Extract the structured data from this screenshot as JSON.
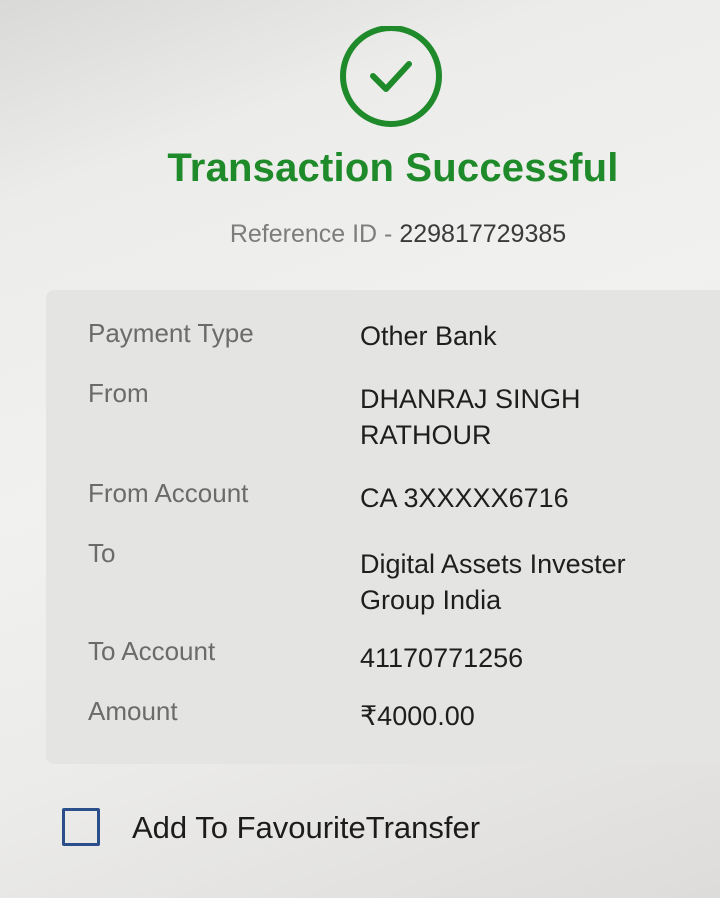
{
  "status": {
    "title": "Transaction Successful",
    "icon": "checkmark-circle-icon",
    "color": "#1f8a2a"
  },
  "reference": {
    "label": "Reference ID - ",
    "value": "229817729385"
  },
  "details": {
    "payment_type": {
      "label": "Payment Type",
      "value": "Other Bank"
    },
    "from": {
      "label": "From",
      "value": "DHANRAJ SINGH RATHOUR"
    },
    "from_account": {
      "label": "From Account",
      "value": "CA 3XXXXX6716"
    },
    "to": {
      "label": "To",
      "value": "Digital Assets Invester Group India"
    },
    "to_account": {
      "label": "To Account",
      "value": "41170771256"
    },
    "amount": {
      "label": "Amount",
      "value": "₹4000.00"
    }
  },
  "favourite": {
    "label": "Add To FavouriteTransfer",
    "checked": false
  }
}
